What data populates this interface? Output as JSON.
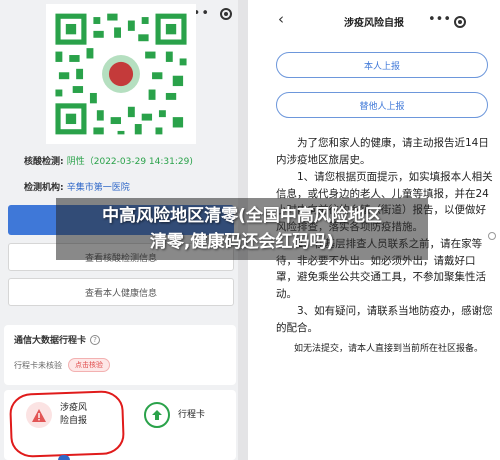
{
  "left": {
    "verify_label": "核酸检测:",
    "verify_value": "阴性（2022-03-29 14:31:29)",
    "institution_label": "检测机构:",
    "institution_value": "辛集市第一医院",
    "button_check_info": "查看核酸检测信息",
    "button_health_info": "查看本人健康信息",
    "trip_title": "通信大数据行程卡",
    "trip_status": "行程卡未核验",
    "trip_tag": "点击核验",
    "feature_report": "涉疫风\n险自报",
    "feature_trip": "行程卡"
  },
  "right": {
    "title": "涉疫风险自报",
    "self_report": "本人上报",
    "proxy_report": "替他人上报",
    "notice": [
      "为了您和家人的健康，请主动报告近14日内涉疫地区旅居史。",
      "1、请您根据页面提示，如实填报本人相关信息，或代身边的老人、儿童等填报，并在24小时内向前往的乡镇（街道）报告，以便做好风险排查，落实各项防疫措施。",
      "2、在基层排查人员联系之前，请在家等待，非必要不外出。如必须外出，请戴好口罩，避免乘坐公共交通工具，不参加聚集性活动。",
      "3、如有疑问，请联系当地防疫办，感谢您的配合。"
    ],
    "footnote": "如无法提交，请本人直接到当前所在社区报备。"
  },
  "banner": {
    "line1": "中高风险地区清零(全国中高风险地区",
    "line2": "清零,健康码还会红码吗)"
  },
  "colors": {
    "accent_blue": "#3f78d8",
    "negative_green": "#2aa24a",
    "highlight_red": "#e01b1b"
  }
}
